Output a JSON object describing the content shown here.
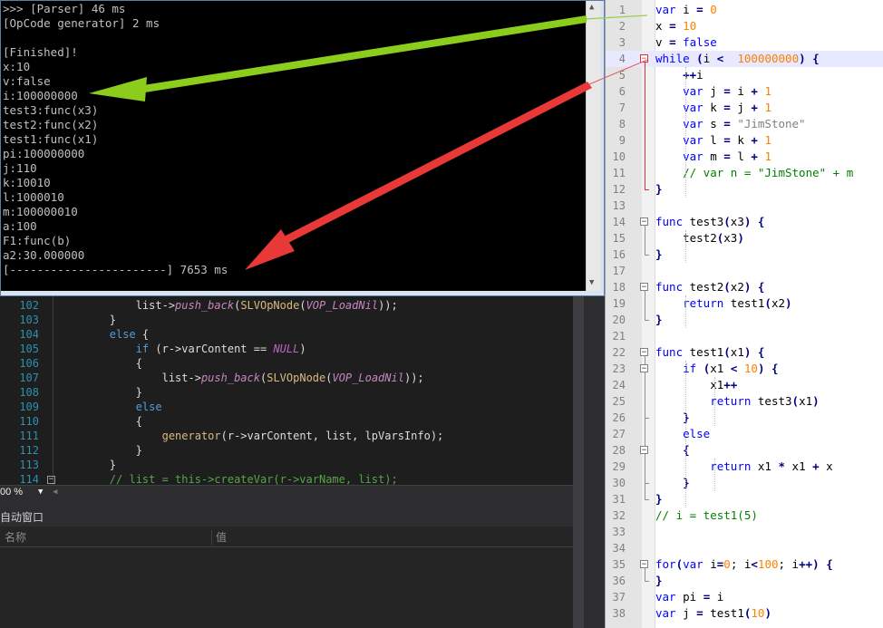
{
  "console": {
    "lines": [
      ">>> [Parser] 46 ms",
      "[OpCode generator] 2 ms",
      "",
      "[Finished]!",
      "x:10",
      "v:false",
      "i:100000000",
      "test3:func(x3)",
      "test2:func(x2)",
      "test1:func(x1)",
      "pi:100000000",
      "j:110",
      "k:10010",
      "l:1000010",
      "m:100000010",
      "a:100",
      "F1:func(b)",
      "a2:30.000000",
      "[-----------------------] 7653 ms"
    ]
  },
  "editor": {
    "lines": [
      {
        "n": "1",
        "t": "var i = 0"
      },
      {
        "n": "2",
        "t": "x = 10"
      },
      {
        "n": "3",
        "t": "v = false"
      },
      {
        "n": "4",
        "t": "while (i <  100000000) {"
      },
      {
        "n": "5",
        "t": "    ++i"
      },
      {
        "n": "6",
        "t": "    var j = i + 1"
      },
      {
        "n": "7",
        "t": "    var k = j + 1"
      },
      {
        "n": "8",
        "t": "    var s = \"JimStone\""
      },
      {
        "n": "9",
        "t": "    var l = k + 1"
      },
      {
        "n": "10",
        "t": "    var m = l + 1"
      },
      {
        "n": "11",
        "t": "    // var n = \"JimStone\" + m"
      },
      {
        "n": "12",
        "t": "}"
      },
      {
        "n": "13",
        "t": ""
      },
      {
        "n": "14",
        "t": "func test3(x3) {"
      },
      {
        "n": "15",
        "t": "    test2(x3)"
      },
      {
        "n": "16",
        "t": "}"
      },
      {
        "n": "17",
        "t": ""
      },
      {
        "n": "18",
        "t": "func test2(x2) {"
      },
      {
        "n": "19",
        "t": "    return test1(x2)"
      },
      {
        "n": "20",
        "t": "}"
      },
      {
        "n": "21",
        "t": ""
      },
      {
        "n": "22",
        "t": "func test1(x1) {"
      },
      {
        "n": "23",
        "t": "    if (x1 < 10) {"
      },
      {
        "n": "24",
        "t": "        x1++"
      },
      {
        "n": "25",
        "t": "        return test3(x1)"
      },
      {
        "n": "26",
        "t": "    }"
      },
      {
        "n": "27",
        "t": "    else"
      },
      {
        "n": "28",
        "t": "    {"
      },
      {
        "n": "29",
        "t": "        return x1 * x1 + x"
      },
      {
        "n": "30",
        "t": "    }"
      },
      {
        "n": "31",
        "t": "}"
      },
      {
        "n": "32",
        "t": "// i = test1(5)"
      },
      {
        "n": "33",
        "t": ""
      },
      {
        "n": "34",
        "t": ""
      },
      {
        "n": "35",
        "t": "for(var i=0; i<100; i++) {"
      },
      {
        "n": "36",
        "t": "}"
      },
      {
        "n": "37",
        "t": "var pi = i"
      },
      {
        "n": "38",
        "t": "var j = test1(10)"
      }
    ]
  },
  "vs": {
    "lines": [
      {
        "n": "102",
        "t": "            list->push_back(SLVOpNode(VOP_LoadNil));"
      },
      {
        "n": "103",
        "t": "        }"
      },
      {
        "n": "104",
        "t": "        else {"
      },
      {
        "n": "105",
        "t": "            if (r->varContent == NULL)"
      },
      {
        "n": "106",
        "t": "            {"
      },
      {
        "n": "107",
        "t": "                list->push_back(SLVOpNode(VOP_LoadNil));"
      },
      {
        "n": "108",
        "t": "            }"
      },
      {
        "n": "109",
        "t": "            else"
      },
      {
        "n": "110",
        "t": "            {"
      },
      {
        "n": "111",
        "t": "                generator(r->varContent, list, lpVarsInfo);"
      },
      {
        "n": "112",
        "t": "            }"
      },
      {
        "n": "113",
        "t": "        }"
      },
      {
        "n": "114",
        "t": "        // list = this->createVar(r->varName, list);"
      }
    ],
    "zoom": "00 %",
    "panel_title": "自动窗口",
    "col_name": "名称",
    "col_value": "值"
  },
  "colors": {
    "arrow_green": "#8ccc1c",
    "arrow_red": "#e83838"
  }
}
